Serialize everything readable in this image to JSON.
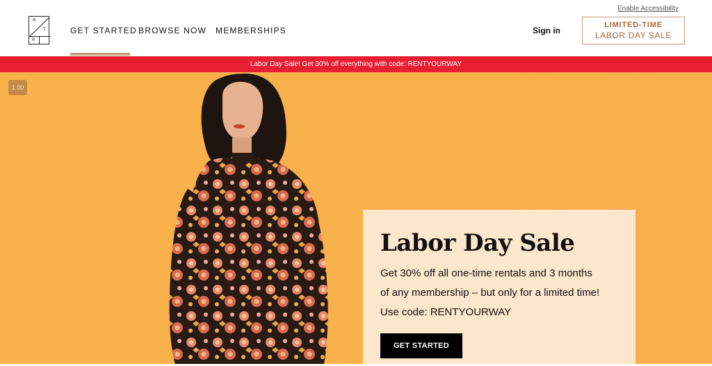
{
  "header": {
    "logo_letters": [
      "R",
      "T",
      "R"
    ],
    "nav": [
      {
        "label": "GET STARTED",
        "active": true
      },
      {
        "label": "BROWSE NOW",
        "active": false
      },
      {
        "label": "MEMBERSHIPS",
        "active": false
      }
    ],
    "accessibility_link": "Enable Accessibility",
    "signin": "Sign in",
    "sale_button": {
      "line1": "LIMITED-TIME",
      "line2": "LABOR DAY SALE"
    }
  },
  "promo_bar": {
    "text": "Labor Day Sale! Get 30% off everything with code: RENTYOURWAY",
    "background": "#e81f32"
  },
  "hero": {
    "zoom_badge": "1.00",
    "background": "#f9b24a",
    "card": {
      "title": "Labor Day Sale",
      "line1": "Get 30% off all one-time rentals and 3 months",
      "line2": "of any membership – but only for a limited time!",
      "line3": "Use code: RENTYOURWAY",
      "cta": "GET STARTED"
    }
  },
  "colors": {
    "accent": "#c4a07a",
    "sale_text": "#a5673f",
    "card_bg": "#fce6cc"
  }
}
